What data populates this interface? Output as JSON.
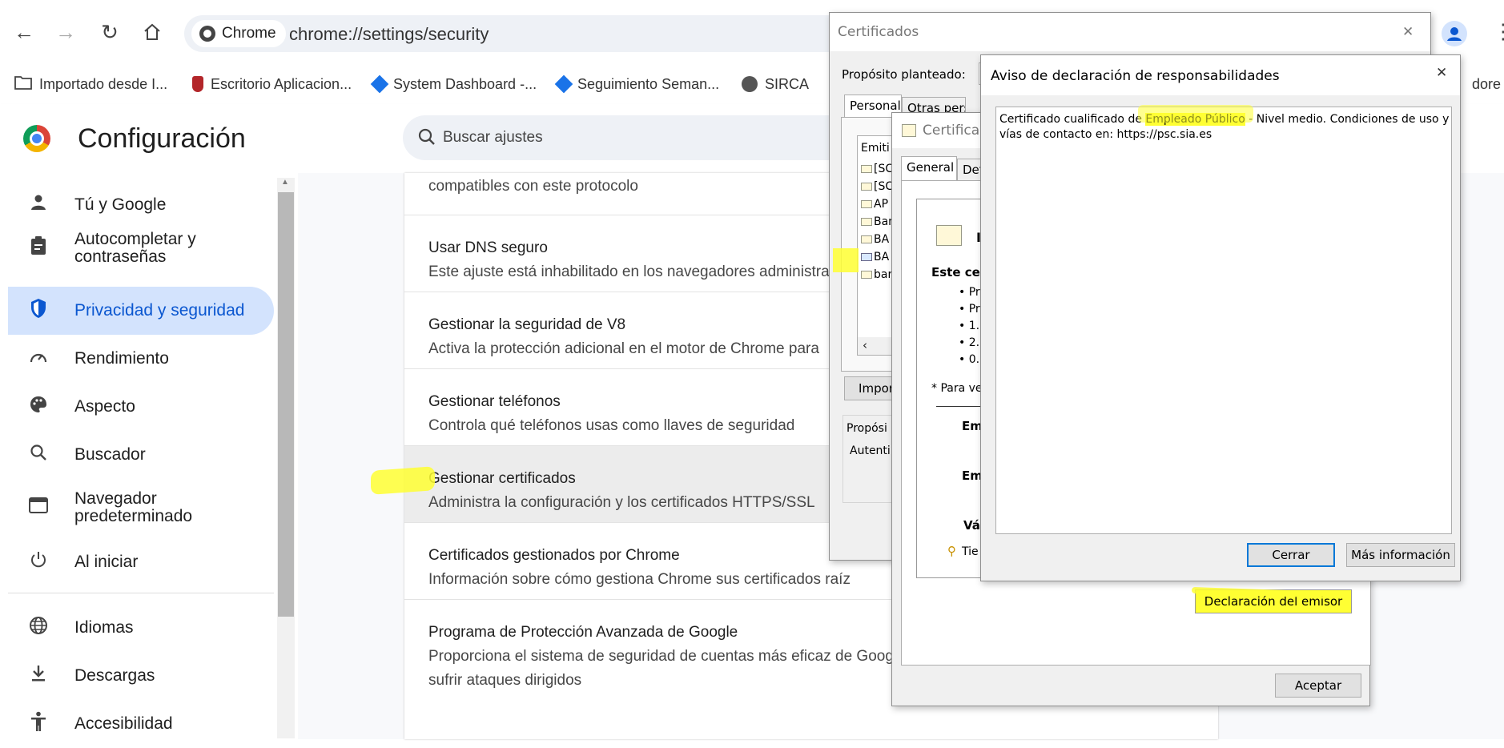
{
  "browser": {
    "chip_label": "Chrome",
    "url": "chrome://settings/security",
    "bookmarks": [
      {
        "label": "Importado desde I..."
      },
      {
        "label": "Escritorio Aplicacion..."
      },
      {
        "label": "System Dashboard -..."
      },
      {
        "label": "Seguimiento Seman..."
      },
      {
        "label": "SIRCA"
      },
      {
        "label": "dore"
      }
    ]
  },
  "settings": {
    "title": "Configuración",
    "search_placeholder": "Buscar ajustes",
    "nav": [
      {
        "label": "Tú y Google",
        "icon": "person-icon"
      },
      {
        "label": "Autocompletar y contraseñas",
        "icon": "clipboard-icon"
      },
      {
        "label": "Privacidad y seguridad",
        "icon": "shield-icon"
      },
      {
        "label": "Rendimiento",
        "icon": "gauge-icon"
      },
      {
        "label": "Aspecto",
        "icon": "palette-icon"
      },
      {
        "label": "Buscador",
        "icon": "search-icon"
      },
      {
        "label": "Navegador predeterminado",
        "icon": "browser-icon"
      },
      {
        "label": "Al iniciar",
        "icon": "power-icon"
      },
      {
        "label": "Idiomas",
        "icon": "globe-icon"
      },
      {
        "label": "Descargas",
        "icon": "download-icon"
      },
      {
        "label": "Accesibilidad",
        "icon": "accessibility-icon"
      }
    ],
    "top_fragment": "compatibles con este protocolo",
    "rows": [
      {
        "title": "Usar DNS seguro",
        "desc": "Este ajuste está inhabilitado en los navegadores administra"
      },
      {
        "title": "Gestionar la seguridad de V8",
        "desc": "Activa la protección adicional en el motor de Chrome para"
      },
      {
        "title": "Gestionar teléfonos",
        "desc": "Controla qué teléfonos usas como llaves de seguridad"
      },
      {
        "title": "Gestionar certificados",
        "desc": "Administra la configuración y los certificados HTTPS/SSL"
      },
      {
        "title": "Certificados gestionados por Chrome",
        "desc": "Información sobre cómo gestiona Chrome sus certificados raíz"
      },
      {
        "title": "Programa de Protección Avanzada de Google",
        "desc": "Proporciona el sistema de seguridad de cuentas más eficaz de Goog",
        "desc2": "sufrir ataques dirigidos"
      }
    ]
  },
  "certificados": {
    "title": "Certificados",
    "purpose_label": "Propósito planteado:",
    "tabs": [
      "Personal",
      "Otras persona"
    ],
    "list_header": "Emiti",
    "list_items": [
      "[SC",
      "[SC",
      "AP",
      "Ban",
      "BA",
      "BA",
      "bar"
    ],
    "import_button": "Impor",
    "purpose_box_label": "Propósi",
    "purpose_box_value": "Autenti"
  },
  "cert_detail": {
    "title": "Certificad",
    "tabs": [
      "General",
      "Deta"
    ],
    "heading": "I",
    "intro": "Este cer",
    "bullets": [
      "• Pr",
      "• Pr",
      "• 1.",
      "• 2.",
      "• 0."
    ],
    "note": "* Para ve",
    "field1": "Em",
    "field2": "Em",
    "field3": "Vá",
    "key_text": "Tie",
    "issuer_button": "Declaración del emisor",
    "ok_button": "Aceptar"
  },
  "aviso": {
    "title": "Aviso de declaración de responsabilidades",
    "text_before": "Certificado cualificado de ",
    "text_highlight": "Empleado Público",
    "text_after": " - Nivel medio. Condiciones de uso y",
    "text_line2": "vías de contacto en: https://psc.sia.es",
    "close_button": "Cerrar",
    "more_button": "Más información"
  },
  "colors": {
    "accent": "#0b57d0",
    "selected_nav_bg": "#d3e3fd",
    "highlighter": "#ffff33"
  }
}
